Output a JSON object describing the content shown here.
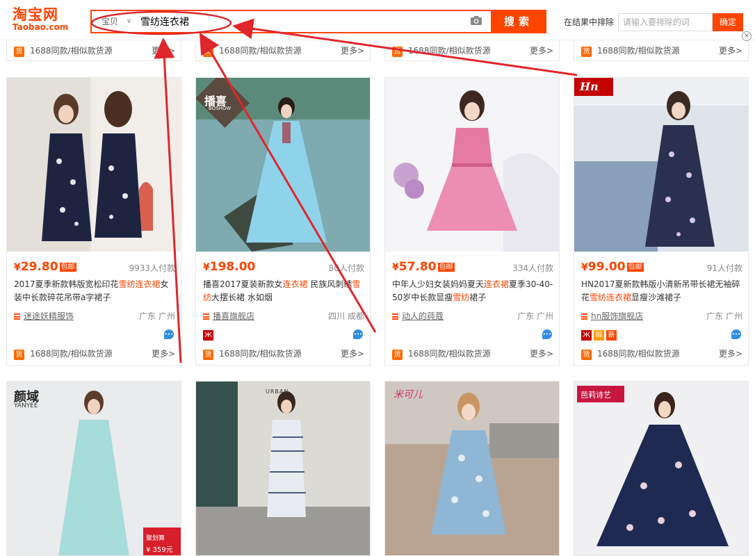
{
  "logo": {
    "cn": "淘宝网",
    "en": "Taobao.com"
  },
  "search": {
    "scope": "宝贝",
    "query": "雪纺连衣裙",
    "button": "搜索"
  },
  "exclude": {
    "label": "在结果中排除",
    "placeholder": "请输入要排除的词",
    "confirm": "确定"
  },
  "close_glyph": "×",
  "source_text": "1688同款/相似款货源",
  "more_text": "更多>",
  "huo_text": "货",
  "baoyou_text": "包邮",
  "yen": "¥",
  "products": [
    {
      "price": "29.80",
      "paid": "9933人付款",
      "title_parts": [
        "2017夏季新款韩版宽松印花",
        "雪纺连衣裙",
        "女装中长款碎花吊带a字裙子"
      ],
      "shop": "迷途妖精服饰",
      "location": "广东 广州",
      "badges": [],
      "accent": "#1e2440"
    },
    {
      "price": "198.00",
      "paid": "80人付款",
      "title_parts": [
        "播喜2017夏装新款女",
        "连衣裙",
        " 民族风刺绣",
        "雪纺",
        "大摆长裙 水如烟"
      ],
      "shop": "播喜旗舰店",
      "location": "四川 成都",
      "badges": [
        "tmall"
      ],
      "accent": "#8fd3ea",
      "brand": "播喜",
      "brand_en": "BOSHOW"
    },
    {
      "price": "57.80",
      "paid": "334人付款",
      "title_parts": [
        "中年人少妇女装妈妈夏天",
        "连衣裙",
        "夏季30-40-50岁中长款显瘦",
        "雪纺",
        "裙子"
      ],
      "shop": "动人的莼蔻",
      "location": "广东 广州",
      "badges": [],
      "accent": "#e67aa3"
    },
    {
      "price": "99.00",
      "paid": "91人付款",
      "title_parts": [
        "HN2017夏新款韩版小清新吊带长裙无袖碎花",
        "雪纺连衣裙",
        "显瘦沙滩裙子"
      ],
      "shop": "hn服饰旗舰店",
      "location": "广东 广州",
      "badges": [
        "tmall",
        "xiang",
        "xin"
      ],
      "badge_text": {
        "xiang": "赊",
        "xin": "新"
      },
      "accent": "#2a3150",
      "brand": "Hn"
    }
  ],
  "bottom_brands": [
    "颜域",
    "YANYEE",
    "URBAN",
    "米可儿",
    "芭莉诗艺",
    "聚划算",
    "¥ 359元"
  ]
}
